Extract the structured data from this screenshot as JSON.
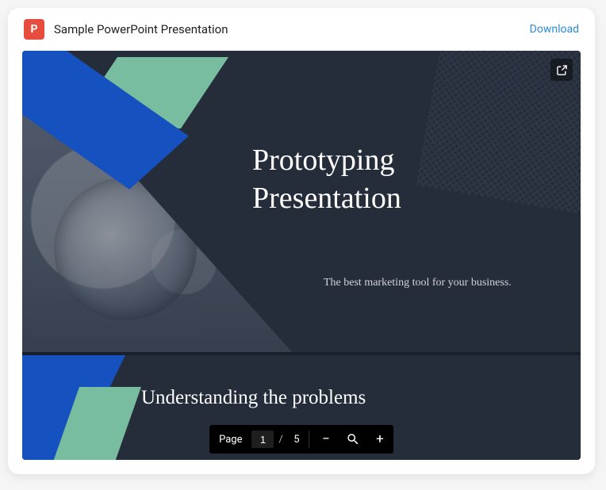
{
  "header": {
    "icon_letter": "P",
    "title": "Sample PowerPoint Presentation",
    "download_label": "Download"
  },
  "slide1": {
    "title_line1": "Prototyping",
    "title_line2": "Presentation",
    "subtitle": "The best marketing tool for your business."
  },
  "slide2": {
    "title": "Understanding the problems"
  },
  "pager": {
    "label": "Page",
    "current": "1",
    "separator": "/",
    "total": "5",
    "minus": "−",
    "plus": "+"
  }
}
